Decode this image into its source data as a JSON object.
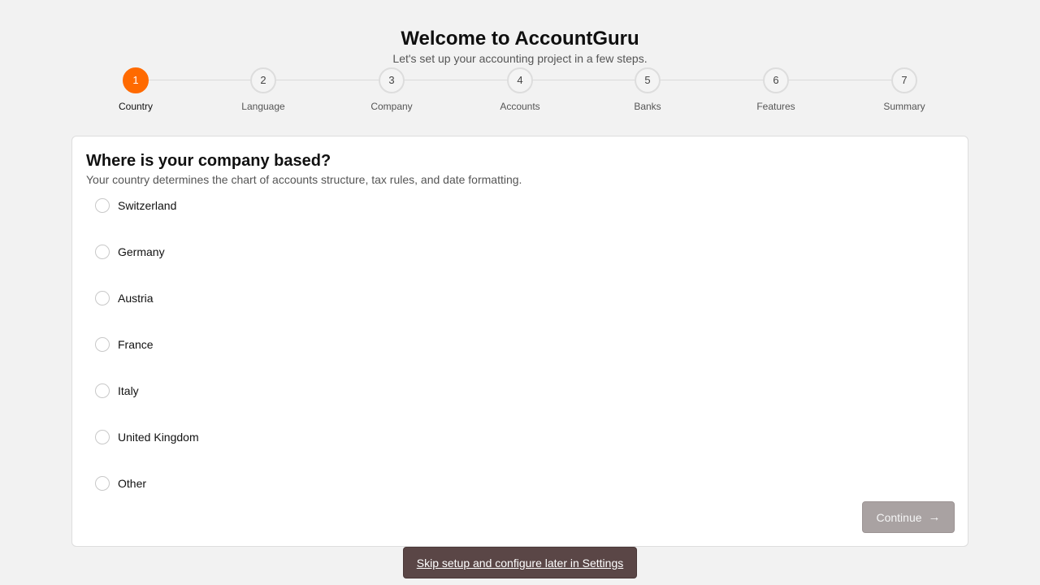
{
  "header": {
    "title": "Welcome to AccountGuru",
    "subtitle": "Let's set up your accounting project in a few steps."
  },
  "stepper": {
    "active_step": 1,
    "steps": [
      {
        "number": "1",
        "label": "Country"
      },
      {
        "number": "2",
        "label": "Language"
      },
      {
        "number": "3",
        "label": "Company"
      },
      {
        "number": "4",
        "label": "Accounts"
      },
      {
        "number": "5",
        "label": "Banks"
      },
      {
        "number": "6",
        "label": "Features"
      },
      {
        "number": "7",
        "label": "Summary"
      }
    ]
  },
  "card": {
    "title": "Where is your company based?",
    "description": "Your country determines the chart of accounts structure, tax rules, and date formatting.",
    "options": [
      {
        "label": "Switzerland",
        "selected": false
      },
      {
        "label": "Germany",
        "selected": false
      },
      {
        "label": "Austria",
        "selected": false
      },
      {
        "label": "France",
        "selected": false
      },
      {
        "label": "Italy",
        "selected": false
      },
      {
        "label": "United Kingdom",
        "selected": false
      },
      {
        "label": "Other",
        "selected": false
      }
    ],
    "continue_label": "Continue",
    "continue_icon": "arrow-right-icon"
  },
  "footer": {
    "skip_label": "Skip setup and configure later in Settings"
  },
  "colors": {
    "accent": "#ff6a00",
    "continue_disabled": "#a9a2a2",
    "skip_background": "#5a4646"
  }
}
